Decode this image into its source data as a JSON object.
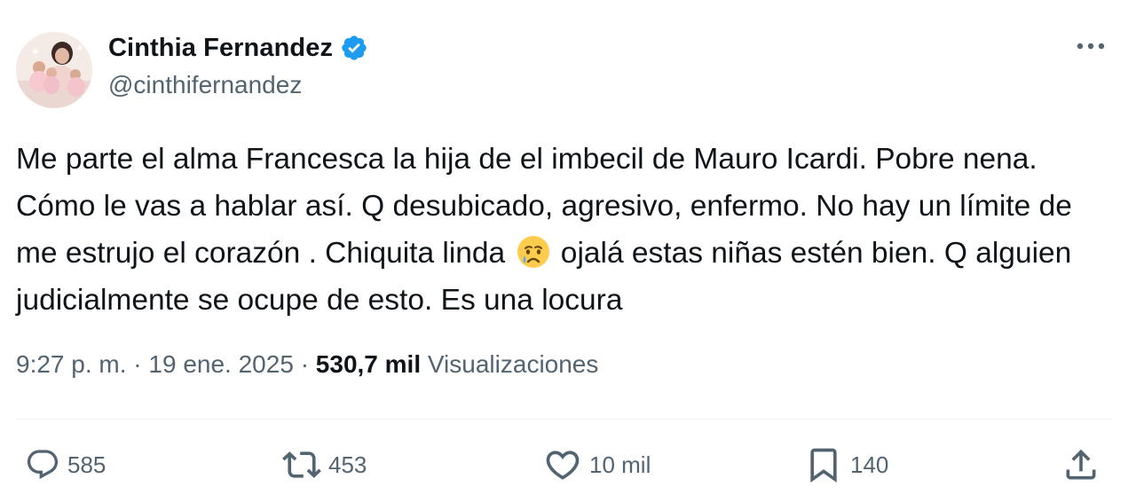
{
  "author": {
    "display_name": "Cinthia Fernandez",
    "handle": "@cinthifernandez",
    "verified": true
  },
  "tweet": {
    "text_before_emoji": "Me parte el alma Francesca la hija de el imbecil de Mauro Icardi. Pobre nena. Cómo le vas a hablar así. Q desubicado, agresivo, enfermo. No hay un límite de me estrujo el corazón . Chiquita linda ",
    "emoji": "crying-face-emoji",
    "text_after_emoji": " ojalá estas niñas estén bien. Q alguien judicialmente se ocupe de esto. Es una locura",
    "time": "9:27 p. m.",
    "separator": "·",
    "date": "19 ene. 2025",
    "views_count": "530,7 mil",
    "views_label": "Visualizaciones"
  },
  "actions": {
    "replies": "585",
    "retweets": "453",
    "likes": "10 mil",
    "bookmarks": "140"
  },
  "icons": {
    "more": "more-dots-icon",
    "reply": "reply-icon",
    "retweet": "retweet-icon",
    "like": "heart-icon",
    "bookmark": "bookmark-icon",
    "share": "share-icon",
    "verified": "verified-badge-icon"
  },
  "colors": {
    "text_primary": "#0f1419",
    "text_secondary": "#536471",
    "verified_blue": "#1d9bf0",
    "divider": "#eff3f4"
  }
}
